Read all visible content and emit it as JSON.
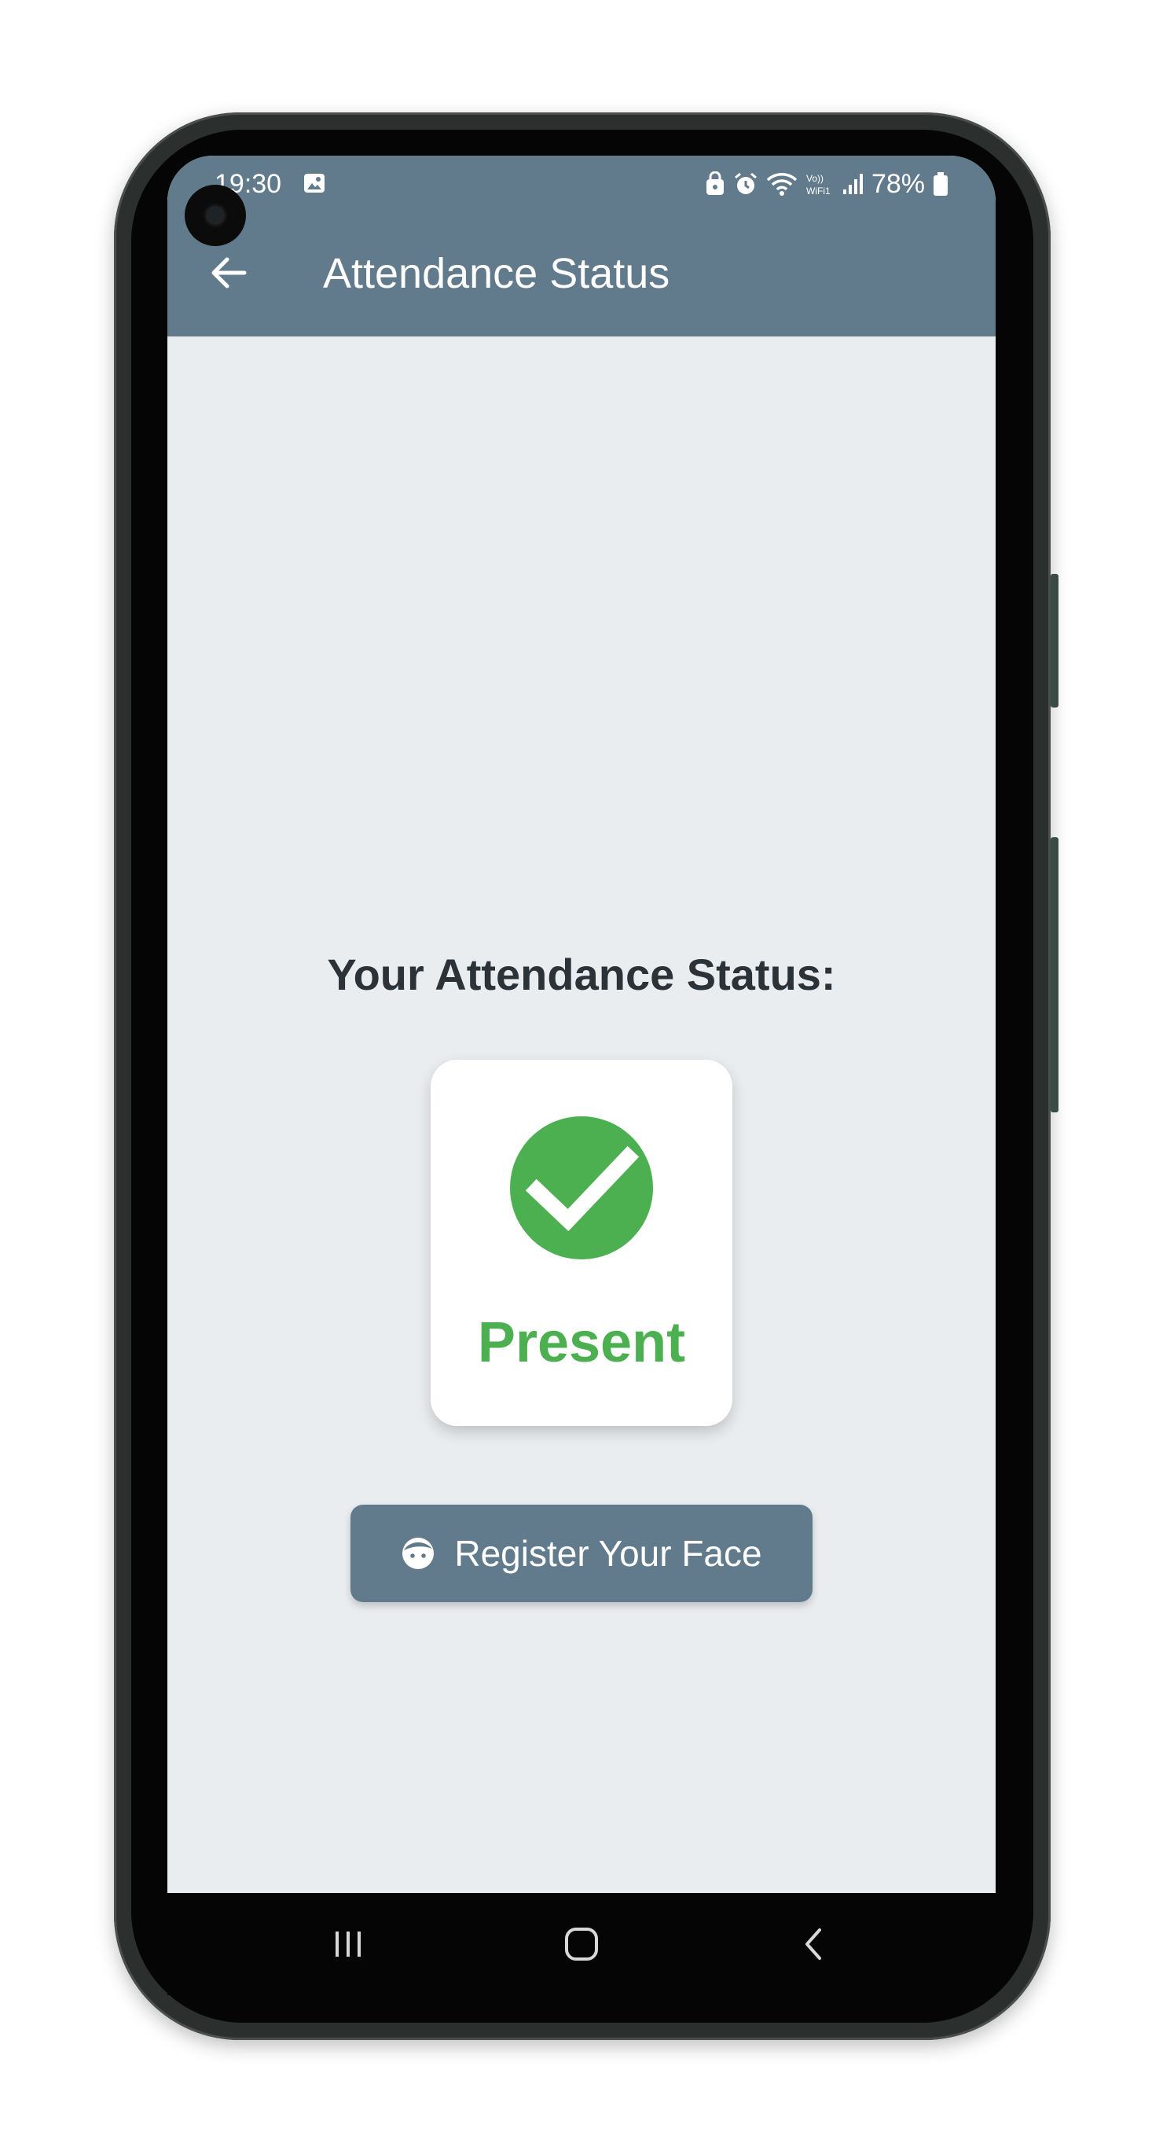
{
  "status_bar": {
    "time": "19:30",
    "battery": "78%",
    "icons": [
      "gallery-icon",
      "lock-icon",
      "alarm-icon",
      "wifi-icon",
      "vowifi-icon",
      "signal-icon",
      "battery-icon"
    ]
  },
  "appbar": {
    "back_icon": "arrow-left-icon",
    "title": "Attendance Status"
  },
  "main": {
    "heading": "Your Attendance Status:",
    "status": {
      "label": "Present",
      "icon": "check-circle-icon",
      "color": "#4caf50"
    },
    "register_button": {
      "icon": "face-icon",
      "label": "Register Your Face"
    }
  },
  "navigation": {
    "recents_icon": "recents-icon",
    "home_icon": "home-icon",
    "back_icon": "back-chevron-icon"
  },
  "colors": {
    "appbar": "#627b8c",
    "background": "#eaedf0",
    "accent_green": "#4caf50",
    "heading_text": "#2b3238"
  }
}
